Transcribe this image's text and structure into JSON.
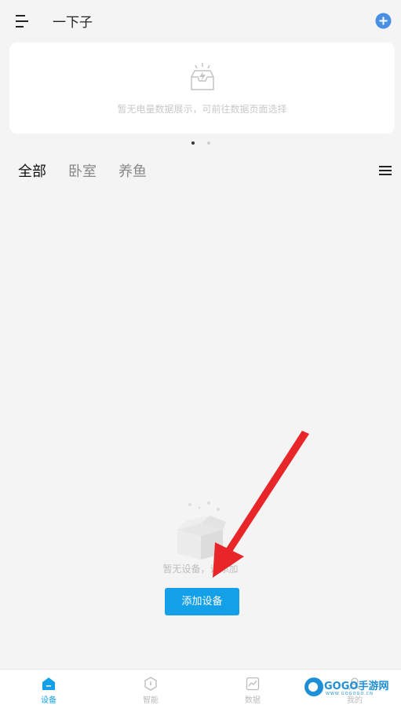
{
  "header": {
    "home_name": "一下子",
    "menu_icon": "menu-icon",
    "add_icon": "plus-circle-icon",
    "accent_color": "#4a90e2"
  },
  "energy_card": {
    "icon": "energy-box-icon",
    "empty_text": "暂无电量数据展示，可前往数据页面选择"
  },
  "carousel": {
    "pages": 2,
    "active_page": 1
  },
  "room_tabs": {
    "items": [
      {
        "label": "全部",
        "active": true
      },
      {
        "label": "卧室",
        "active": false
      },
      {
        "label": "养鱼",
        "active": false
      }
    ],
    "list_icon": "list-icon"
  },
  "empty_state": {
    "icon": "empty-box-icon",
    "text": "暂无设备，请添加",
    "button_label": "添加设备",
    "button_color": "#14a0e8"
  },
  "annotation": {
    "arrow_color": "#e8262a"
  },
  "bottom_nav": {
    "items": [
      {
        "label": "设备",
        "icon": "home-icon",
        "active": true
      },
      {
        "label": "智能",
        "icon": "smart-hexagon-icon",
        "active": false
      },
      {
        "label": "数据",
        "icon": "chart-icon",
        "active": false
      },
      {
        "label": "我的",
        "icon": "user-icon",
        "active": false
      }
    ]
  },
  "watermark": {
    "title": "GOGO手游网",
    "url": "WWW.GOGOGO.CN"
  }
}
